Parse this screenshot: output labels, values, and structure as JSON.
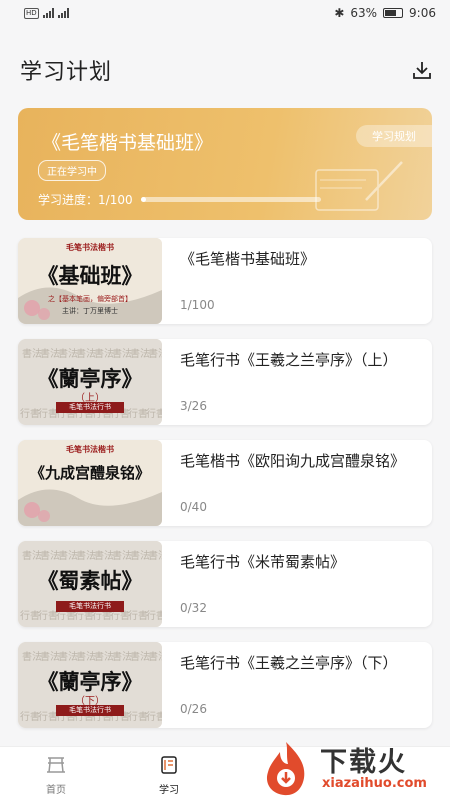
{
  "status_bar": {
    "network": "HD",
    "battery": "63%",
    "time": "9:06"
  },
  "header": {
    "title": "学习计划"
  },
  "plan": {
    "title": "《毛笔楷书基础班》",
    "status": "正在学习中",
    "progress_label": "学习进度：",
    "progress_value": "1/100",
    "progress_fraction": 0.01,
    "button": "学习规划"
  },
  "courses": [
    {
      "title": "《毛笔楷书基础班》",
      "progress": "1/100",
      "cover": {
        "top": "毛笔书法楷书",
        "main": "《基础班》",
        "sub": "之【基本笔画，偏旁部首】",
        "author": "主讲：丁万里博士",
        "style": "ink"
      }
    },
    {
      "title": "毛笔行书《王羲之兰亭序》（上）",
      "progress": "3/26",
      "cover": {
        "main": "《蘭亭序》",
        "vol": "上",
        "band": "毛笔书法行书",
        "style": "grey"
      }
    },
    {
      "title": "毛笔楷书《欧阳询九成宫醴泉铭》",
      "progress": "0/40",
      "cover": {
        "top": "毛笔书法楷书",
        "main": "《九成宫醴泉铭》",
        "style": "ink"
      }
    },
    {
      "title": "毛笔行书《米芾蜀素帖》",
      "progress": "0/32",
      "cover": {
        "main": "《蜀素帖》",
        "band": "毛笔书法行书",
        "style": "grey"
      }
    },
    {
      "title": "毛笔行书《王羲之兰亭序》（下）",
      "progress": "0/26",
      "cover": {
        "main": "《蘭亭序》",
        "vol": "下",
        "band": "毛笔书法行书",
        "style": "grey"
      }
    }
  ],
  "tabs": [
    {
      "label": "首页",
      "active": false
    },
    {
      "label": "学习",
      "active": true
    }
  ],
  "watermark": {
    "text": "下载火",
    "url": "xiazaihuo.com"
  },
  "colors": {
    "accent": "#e8b35c",
    "watermark": "#e14b2c"
  }
}
